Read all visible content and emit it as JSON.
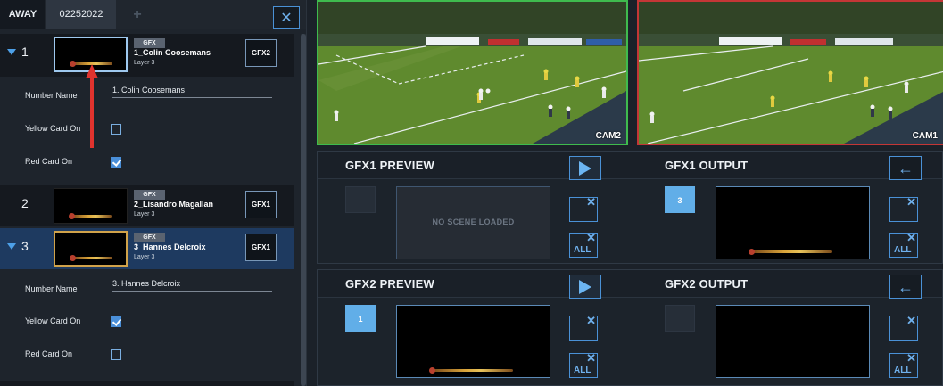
{
  "tabs": [
    "AWAY",
    "02252022"
  ],
  "tab_add_symbol": "+",
  "close_symbol": "✕",
  "items": [
    {
      "number": "1",
      "tag": "GFX",
      "name": "1_Colin Coosemans",
      "layer": "Layer 3",
      "button": "GFX2",
      "props": {
        "number_name_label": "Number Name",
        "number_name_value": "1. Colin Coosemans",
        "yellow_label": "Yellow Card On",
        "yellow_checked": false,
        "red_label": "Red Card On",
        "red_checked": true
      }
    },
    {
      "number": "2",
      "tag": "GFX",
      "name": "2_Lisandro Magallan",
      "layer": "Layer 3",
      "button": "GFX1"
    },
    {
      "number": "3",
      "tag": "GFX",
      "name": "3_Hannes Delcroix",
      "layer": "Layer 3",
      "button": "GFX1",
      "props": {
        "number_name_label": "Number Name",
        "number_name_value": "3. Hannes Delcroix",
        "yellow_label": "Yellow Card On",
        "yellow_checked": true,
        "red_label": "Red Card On",
        "red_checked": false
      }
    }
  ],
  "cameras": [
    {
      "label": "CAM2",
      "tally": "#3fbb4e"
    },
    {
      "label": "CAM1",
      "tally": "#c43636"
    }
  ],
  "gfx1": {
    "preview_title": "GFX1 PREVIEW",
    "output_title": "GFX1 OUTPUT",
    "preview_message": "NO SCENE LOADED",
    "output_slot": "3",
    "clear_all": "ALL",
    "back_symbol": "←"
  },
  "gfx2": {
    "preview_title": "GFX2 PREVIEW",
    "output_title": "GFX2 OUTPUT",
    "preview_slot": "1",
    "clear_all": "ALL",
    "back_symbol": "←"
  },
  "colors": {
    "accent": "#4a91d6",
    "selected_row": "#1e3a60",
    "tally_preview": "#3fbb4e",
    "tally_program": "#c43636",
    "arrow": "#e0332e"
  }
}
